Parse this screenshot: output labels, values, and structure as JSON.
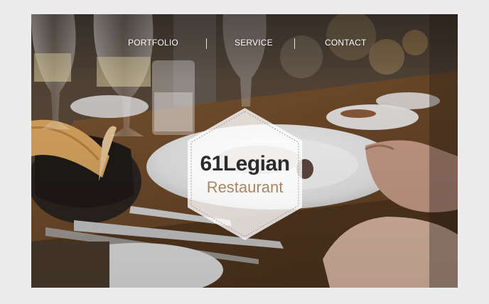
{
  "nav": {
    "items": [
      {
        "label": "PORTFOLIO"
      },
      {
        "label": "SERVICE"
      },
      {
        "label": "CONTACT"
      }
    ]
  },
  "logo": {
    "title": "61Legian",
    "subtitle": "Restaurant"
  },
  "colors": {
    "page_background": "#ececec",
    "logo_title": "#2b2b2b",
    "logo_subtitle": "#a88661",
    "nav_text": "#ffffff"
  }
}
